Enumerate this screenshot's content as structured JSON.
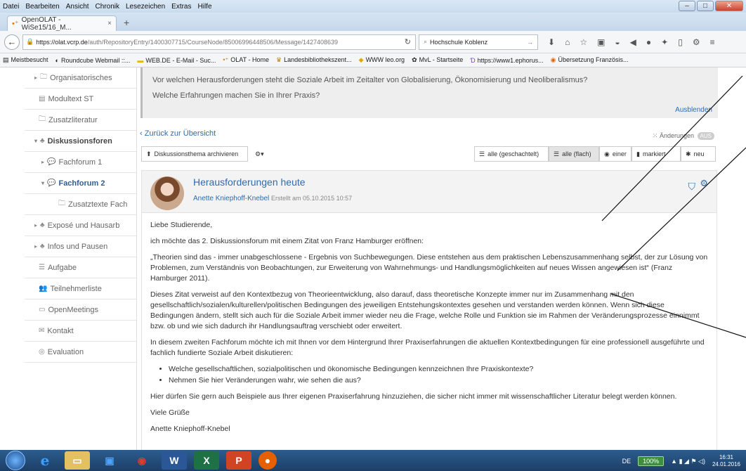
{
  "menubar": {
    "items": [
      "Datei",
      "Bearbeiten",
      "Ansicht",
      "Chronik",
      "Lesezeichen",
      "Extras",
      "Hilfe"
    ]
  },
  "browser": {
    "tab_title": "OpenOLAT - WiSe15/16_M...",
    "url_host": "https://olat.vcrp.de",
    "url_path": "/auth/RepositoryEntry/1400307715/CourseNode/85006996448506/Message/1427408639",
    "search_text": "Hochschule Koblenz"
  },
  "bookmarks": [
    "Meistbesucht",
    "Roundcube Webmail ::...",
    "WEB.DE - E-Mail - Suc...",
    "OLAT - Home",
    "Landesbibliothekszent...",
    "WWW leo.org",
    "MvL - Startseite",
    "https://www1.ephorus...",
    "Übersetzung Französis..."
  ],
  "sidebar": {
    "items": [
      {
        "label": "Organisatorisches",
        "icon": "folder-icon",
        "arrow": "▸"
      },
      {
        "label": "Modultext ST",
        "icon": "document-icon",
        "arrow": ""
      },
      {
        "label": "Zusatzliteratur",
        "icon": "folder-icon",
        "arrow": ""
      },
      {
        "label": "Diskussionsforen",
        "icon": "group-icon",
        "arrow": "▾"
      },
      {
        "label": "Fachforum 1",
        "icon": "chat-icon",
        "arrow": "▸"
      },
      {
        "label": "Fachforum 2",
        "icon": "chat-icon",
        "arrow": "▾"
      },
      {
        "label": "Zusatztexte Fach",
        "icon": "folder-icon",
        "arrow": ""
      },
      {
        "label": "Exposé und Hausarb",
        "icon": "group-icon",
        "arrow": "▸"
      },
      {
        "label": "Infos und Pausen",
        "icon": "group-icon",
        "arrow": "▸"
      },
      {
        "label": "Aufgabe",
        "icon": "task-icon",
        "arrow": ""
      },
      {
        "label": "Teilnehmerliste",
        "icon": "people-icon",
        "arrow": ""
      },
      {
        "label": "OpenMeetings",
        "icon": "monitor-icon",
        "arrow": ""
      },
      {
        "label": "Kontakt",
        "icon": "mail-icon",
        "arrow": ""
      },
      {
        "label": "Evaluation",
        "icon": "evaluation-icon",
        "arrow": ""
      }
    ]
  },
  "task": {
    "line1": "Vor welchen Herausforderungen steht die Soziale Arbeit im Zeitalter von Globalisierung, Ökonomisierung und Neoliberalismus?",
    "line2": "Welche Erfahrungen machen Sie in Ihrer Praxis?",
    "hide_label": "Ausblenden"
  },
  "forum": {
    "back_label": "Zurück zur Übersicht",
    "changes_label": "Änderungen",
    "changes_toggle": "AUS",
    "archive_label": "Diskussionsthema archivieren",
    "view_threaded": "alle (geschachtelt)",
    "view_flat": "alle (flach)",
    "view_one": "einer",
    "view_marked": "markiert",
    "view_new": "neu"
  },
  "post": {
    "title": "Herausforderungen heute",
    "author": "Anette Kniephoff-Knebel",
    "created": "Erstellt am 05.10.2015 10:57",
    "greeting": "Liebe Studierende,",
    "intro": "ich möchte das 2. Diskussionsforum mit einem Zitat von Franz Hamburger eröffnen:",
    "quote": "„Theorien sind das - immer unabgeschlossene - Ergebnis von Suchbewegungen. Diese entstehen aus dem praktischen Lebenszusammenhang selbst, der zur Lösung von Problemen, zum Verständnis von Beobachtungen, zur Erweiterung von Wahrnehmungs- und Handlungsmöglichkeiten auf neues Wissen angewiesen ist“ (Franz Hamburger 2011).",
    "paragraph1": "Dieses Zitat verweist auf den Kontextbezug von Theorieentwicklung, also darauf, dass theoretische Konzepte immer nur im Zusammenhang mit den gesellschaftlich/sozialen/kulturellen/politischen Bedingungen des jeweiligen Entstehungskontextes gesehen und verstanden werden können. Wenn sich diese Bedingungen ändern, stellt sich auch für die Soziale Arbeit immer wieder neu die Frage, welche Rolle und Funktion sie im Rahmen der Veränderungsprozesse einnimmt bzw. ob und wie sich dadurch ihr Handlungsauftrag verschiebt oder erweitert.",
    "paragraph2": "In diesem zweiten Fachforum möchte ich mit Ihnen vor dem Hintergrund Ihrer Praxiserfahrungen die aktuellen Kontextbedingungen für eine professionell ausgeführte und fachlich fundierte Soziale Arbeit diskutieren:",
    "bullets": [
      "Welche gesellschaftlichen, sozialpolitischen und ökonomische Bedingungen kennzeichnen Ihre Praxiskontexte?",
      "Nehmen Sie hier Veränderungen wahr, wie sehen die aus?"
    ],
    "paragraph3": "Hier dürfen Sie gern auch Beispiele aus Ihrer eigenen Praxiserfahrung hinzuziehen, die sicher nicht immer mit wissenschaftlicher Literatur belegt werden können.",
    "closing": "Viele Grüße",
    "signature": "Anette Kniephoff-Knebel"
  },
  "taskbar": {
    "lang": "DE",
    "battery": "100%",
    "time": "16:31",
    "date": "24.01.2016"
  },
  "colors": {
    "link": "#2e6bb0",
    "taskbar": "#1c3f66"
  }
}
